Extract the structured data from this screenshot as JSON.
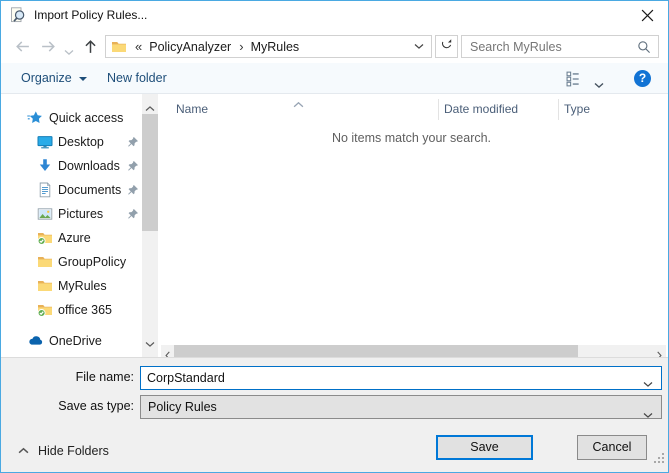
{
  "window": {
    "title": "Import Policy Rules..."
  },
  "nav": {
    "breadcrumb": {
      "collapsed_marker": "«",
      "segments": [
        "PolicyAnalyzer",
        "MyRules"
      ],
      "separator": "›"
    },
    "search_placeholder": "Search MyRules"
  },
  "toolbar": {
    "organize_label": "Organize",
    "new_folder_label": "New folder",
    "help_glyph": "?"
  },
  "sidebar": {
    "items": [
      {
        "label": "Quick access",
        "icon": "quick-access-icon",
        "indent": 0,
        "pinned": false
      },
      {
        "label": "Desktop",
        "icon": "desktop-icon",
        "indent": 1,
        "pinned": true
      },
      {
        "label": "Downloads",
        "icon": "downloads-icon",
        "indent": 1,
        "pinned": true
      },
      {
        "label": "Documents",
        "icon": "documents-icon",
        "indent": 1,
        "pinned": true
      },
      {
        "label": "Pictures",
        "icon": "pictures-icon",
        "indent": 1,
        "pinned": true
      },
      {
        "label": "Azure",
        "icon": "folder-synced-icon",
        "indent": 1,
        "pinned": false
      },
      {
        "label": "GroupPolicy",
        "icon": "folder-icon",
        "indent": 1,
        "pinned": false
      },
      {
        "label": "MyRules",
        "icon": "folder-icon",
        "indent": 1,
        "pinned": false
      },
      {
        "label": "office 365",
        "icon": "folder-synced-icon",
        "indent": 1,
        "pinned": false
      },
      {
        "label": "OneDrive",
        "icon": "onedrive-icon",
        "indent": 0,
        "pinned": false,
        "group_gap": true
      }
    ]
  },
  "file_list": {
    "columns": [
      "Name",
      "Date modified",
      "Type"
    ],
    "empty_message": "No items match your search."
  },
  "form": {
    "file_name_label": "File name:",
    "file_name_value": "CorpStandard",
    "save_as_type_label": "Save as type:",
    "save_as_type_value": "Policy Rules"
  },
  "footer": {
    "hide_folders_label": "Hide Folders",
    "save_label": "Save",
    "cancel_label": "Cancel"
  },
  "colors": {
    "accent": "#0078d7",
    "window_border": "#4aa9e2",
    "toolbar_text": "#1e4e79",
    "header_text": "#4a5e78"
  }
}
